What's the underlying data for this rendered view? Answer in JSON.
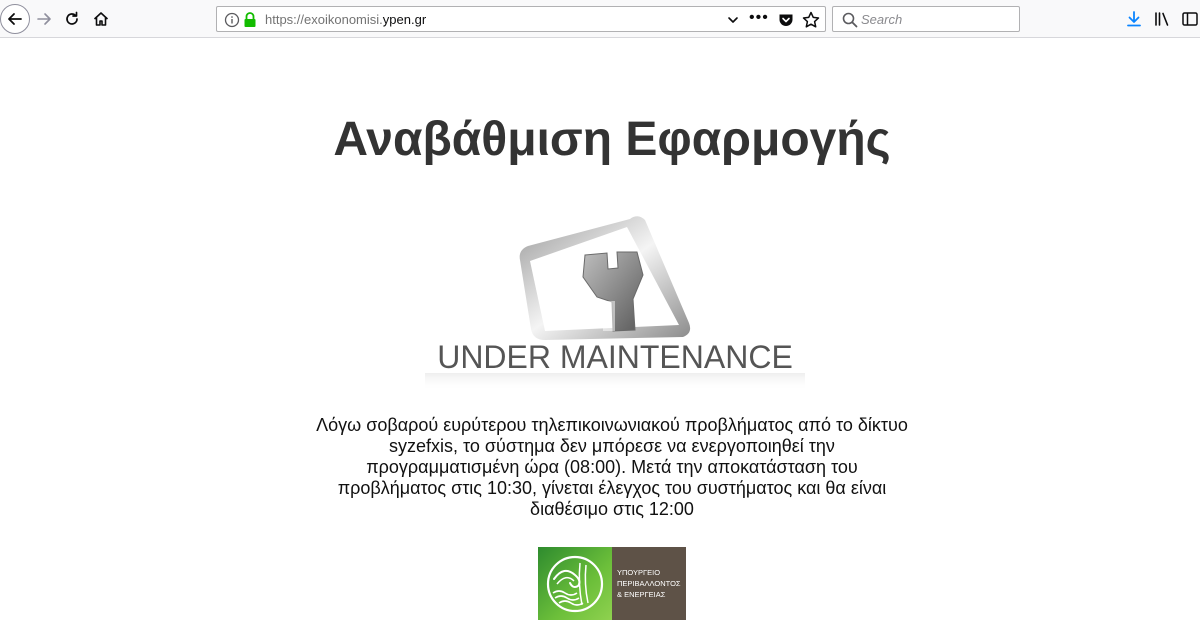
{
  "browser": {
    "url_prefix": "https://exoikonomisi.",
    "url_host": "ypen.gr",
    "search_placeholder": "Search",
    "more_label": "•••"
  },
  "page": {
    "title": "Αναβάθμιση Εφαρμογής",
    "maintenance_caption": "UNDER MAINTENANCE",
    "message": "Λόγω σοβαρού ευρύτερου τηλεπικοινωνιακού προβλήματος από το δίκτυο syzefxis, το σύστημα δεν μπόρεσε να ενεργοποιηθεί την προγραμματισμένη ώρα (08:00). Μετά την αποκατάσταση του προβλήματος στις 10:30, γίνεται έλεγχος του συστήματος και θα είναι διαθέσιμο στις 12:00",
    "logo_lines": [
      "ΥΠΟΥΡΓΕΙΟ",
      "ΠΕΡΙΒΑΛΛΟΝΤΟΣ",
      "& ΕΝΕΡΓΕΙΑΣ"
    ]
  },
  "colors": {
    "title": "#333333",
    "lock_green": "#12bc00",
    "download_blue": "#0a84ff",
    "logo_green": "#3a9a32",
    "logo_brown": "#5e5247"
  },
  "icons": {
    "back": "back-arrow-icon",
    "forward": "forward-arrow-icon",
    "reload": "reload-icon",
    "home": "home-icon",
    "info": "info-icon",
    "lock": "lock-icon",
    "chevron": "chevron-down-icon",
    "pocket": "pocket-icon",
    "star": "star-icon",
    "search": "search-icon",
    "download": "download-icon",
    "library": "library-icon",
    "sidebar": "sidebar-icon",
    "wrench": "wrench-icon"
  }
}
